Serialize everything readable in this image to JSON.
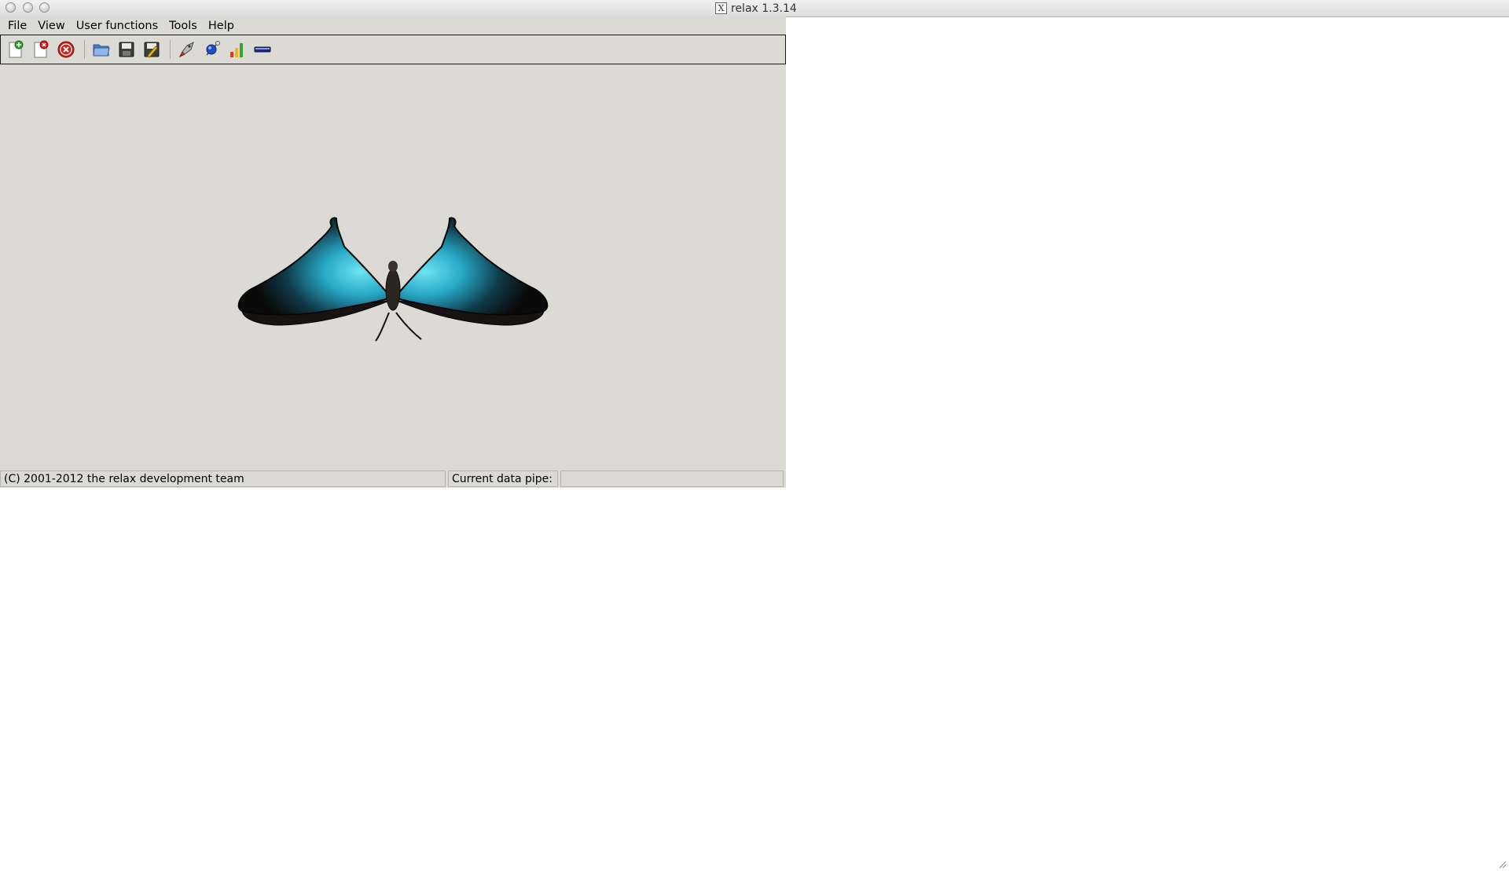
{
  "window": {
    "title": "relax 1.3.14",
    "x11_icon_glyph": "X"
  },
  "menubar": {
    "items": [
      "File",
      "View",
      "User functions",
      "Tools",
      "Help"
    ]
  },
  "toolbar": {
    "buttons": [
      {
        "icon": "new-analysis-icon"
      },
      {
        "icon": "close-analysis-icon"
      },
      {
        "icon": "close-all-analyses-icon"
      },
      {
        "icon": "open-folder-icon"
      },
      {
        "icon": "save-icon"
      },
      {
        "icon": "save-as-icon"
      },
      {
        "icon": "launch-rocket-icon"
      },
      {
        "icon": "molecule-icon"
      },
      {
        "icon": "bar-chart-icon"
      },
      {
        "icon": "spin-viewer-icon"
      }
    ]
  },
  "canvas": {
    "image": "butterfly-logo"
  },
  "statusbar": {
    "copyright": "(C) 2001-2012 the relax development team",
    "pipe_label": "Current data pipe:",
    "pipe_value": ""
  },
  "colors": {
    "background": "#dcdad5",
    "wing_blue": "#2fb8d0",
    "wing_dark": "#111111"
  }
}
